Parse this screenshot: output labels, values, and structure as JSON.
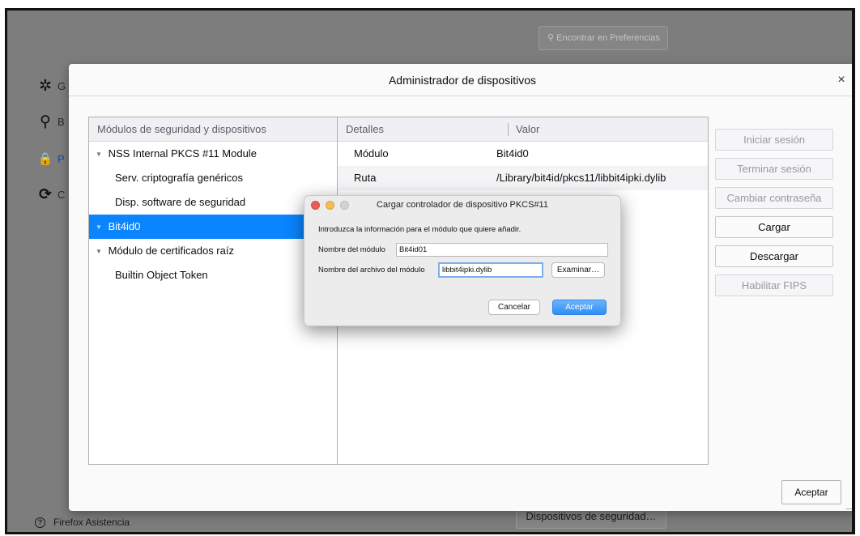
{
  "background": {
    "search_placeholder": "Encontrar en Preferencias",
    "sidebar": [
      {
        "icon": "gear-icon",
        "glyph": "✲",
        "label": "G"
      },
      {
        "icon": "search-icon",
        "glyph": "⚲",
        "label": "B"
      },
      {
        "icon": "lock-icon",
        "glyph": "🔒",
        "label": "P S"
      },
      {
        "icon": "sync-icon",
        "glyph": "⟳",
        "label": "C"
      }
    ],
    "help_label": "Firefox Asistencia",
    "devices_button": "Dispositivos de seguridad…"
  },
  "device_manager": {
    "title": "Administrador de dispositivos",
    "close_glyph": "×",
    "tree_header": "Módulos de seguridad y dispositivos",
    "tree": [
      {
        "label": "NSS Internal PKCS #11 Module",
        "level": 0,
        "expanded": true,
        "selected": false
      },
      {
        "label": "Serv. criptografía genéricos",
        "level": 1,
        "selected": false
      },
      {
        "label": "Disp. software de seguridad",
        "level": 1,
        "selected": false
      },
      {
        "label": "Bit4id0",
        "level": 0,
        "expanded": true,
        "selected": true
      },
      {
        "label": "Módulo de certificados raíz",
        "level": 0,
        "expanded": true,
        "selected": false
      },
      {
        "label": "Builtin Object Token",
        "level": 1,
        "selected": false
      }
    ],
    "details_header": {
      "col1": "Detalles",
      "col2": "Valor"
    },
    "details_rows": [
      {
        "key": "Módulo",
        "value": "Bit4id0"
      },
      {
        "key": "Ruta",
        "value": "/Library/bit4id/pkcs11/libbit4ipki.dylib"
      }
    ],
    "buttons": {
      "login": "Iniciar sesión",
      "logout": "Terminar sesión",
      "change_password": "Cambiar contraseña",
      "load": "Cargar",
      "unload": "Descargar",
      "enable_fips": "Habilitar FIPS"
    },
    "accept": "Aceptar"
  },
  "load_dialog": {
    "title": "Cargar controlador de dispositivo PKCS#11",
    "intro": "Introduzca la información para el módulo que quiere añadir.",
    "module_name_label": "Nombre del módulo",
    "module_name_value": "Bit4id01",
    "file_label": "Nombre del archivo del módulo",
    "file_value": "libbit4ipki.dylib",
    "browse": "Examinar…",
    "cancel": "Cancelar",
    "accept": "Aceptar"
  }
}
